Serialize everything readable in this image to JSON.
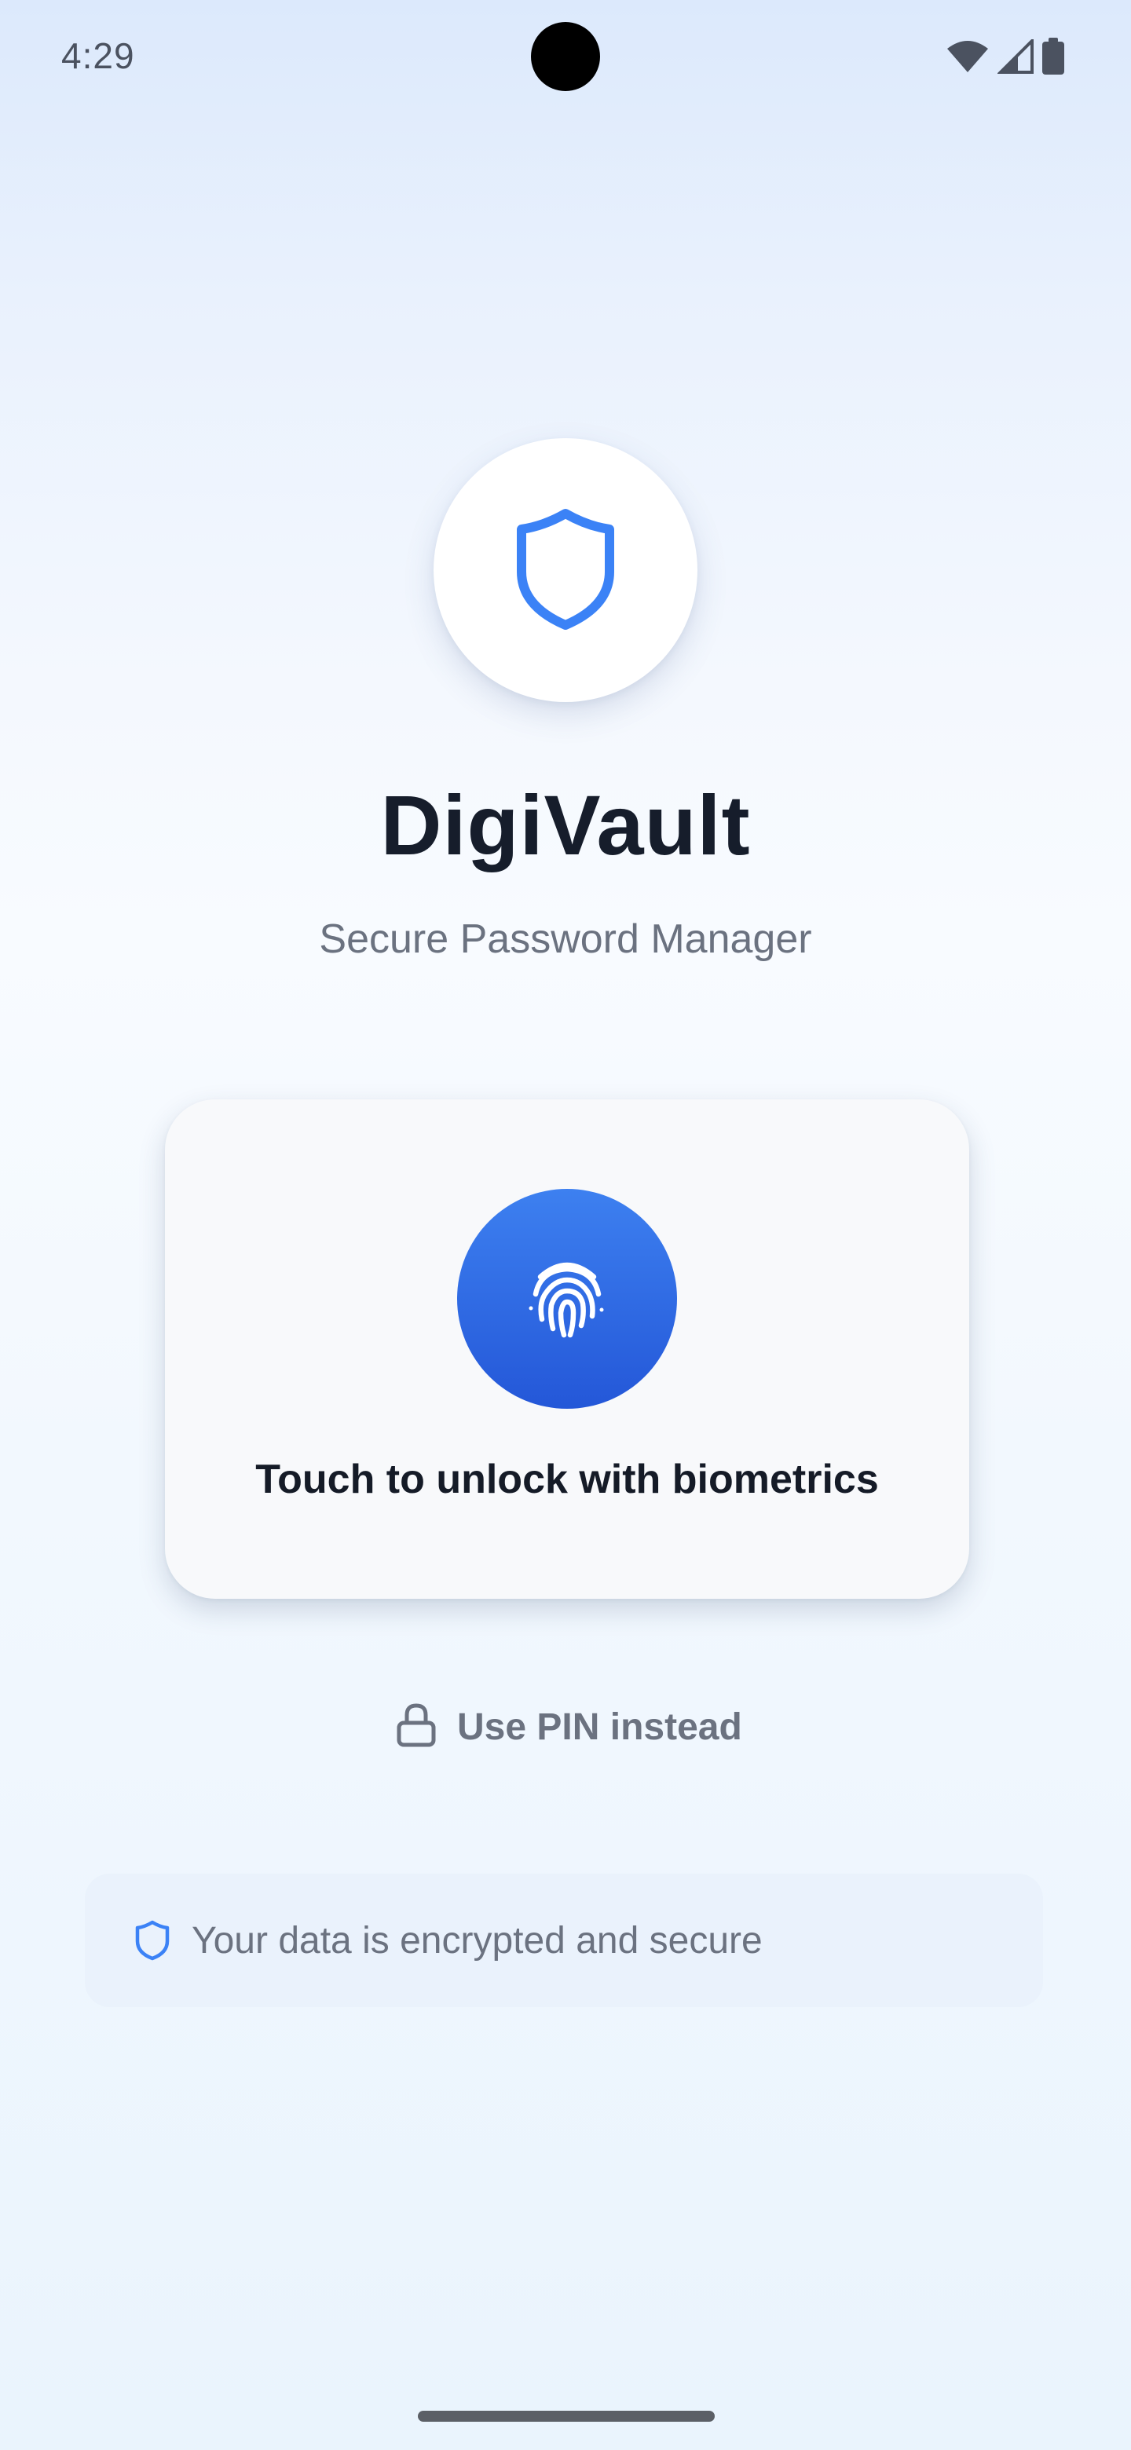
{
  "status_bar": {
    "time": "4:29",
    "icons": [
      "wifi-icon",
      "cellular-signal-icon",
      "battery-icon"
    ]
  },
  "app": {
    "logo_icon": "shield-icon",
    "title": "DigiVault",
    "subtitle": "Secure Password Manager"
  },
  "biometric_card": {
    "icon": "fingerprint-icon",
    "label": "Touch to unlock with biometrics"
  },
  "pin_option": {
    "icon": "lock-icon",
    "label": "Use PIN instead"
  },
  "security_note": {
    "icon": "shield-icon",
    "text": "Your data is encrypted and secure"
  },
  "colors": {
    "accent": "#3b82f6",
    "button_gradient_top": "#3d80f0",
    "button_gradient_bottom": "#2457d8",
    "title_text": "#161d2b",
    "muted_text": "#6b7280"
  }
}
